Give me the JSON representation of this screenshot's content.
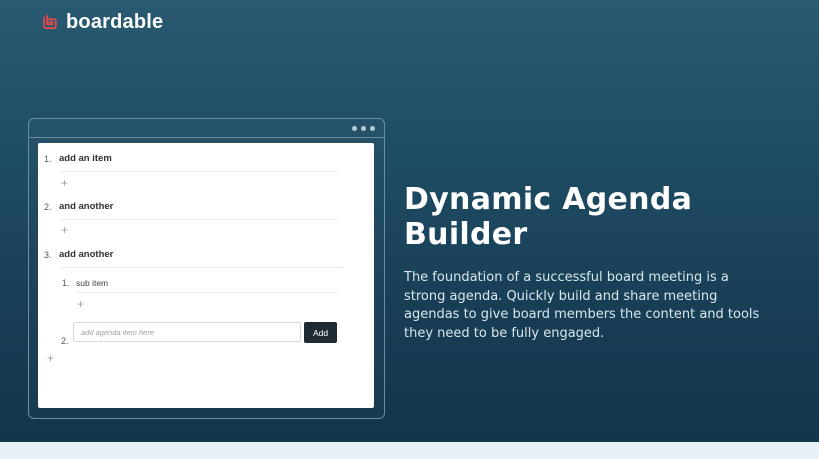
{
  "brand": {
    "name": "boardable",
    "accent_color": "#e5484d",
    "logo_icon": "boardable-logo-icon"
  },
  "agenda_mock": {
    "window_dots": [
      "dot",
      "dot",
      "dot"
    ],
    "items": [
      {
        "number": "1.",
        "label": "add an item"
      },
      {
        "number": "2.",
        "label": "and another"
      },
      {
        "number": "3.",
        "label": "add another"
      }
    ],
    "sub_items": [
      {
        "number": "1.",
        "label": "sub item"
      }
    ],
    "new_item": {
      "number": "2.",
      "input_value": "",
      "input_placeholder": "add agenda item here",
      "add_button_label": "Add"
    },
    "add_icon": "plus-icon"
  },
  "feature": {
    "title": "Dynamic Agenda Builder",
    "description": "The foundation of a successful board meeting is a strong agenda. Quickly build and share meeting agendas to give board members the content and tools they need to be fully engaged."
  },
  "colors": {
    "background_top": "#285a71",
    "background_bottom": "#133549",
    "button_dark": "#1f2a33"
  }
}
